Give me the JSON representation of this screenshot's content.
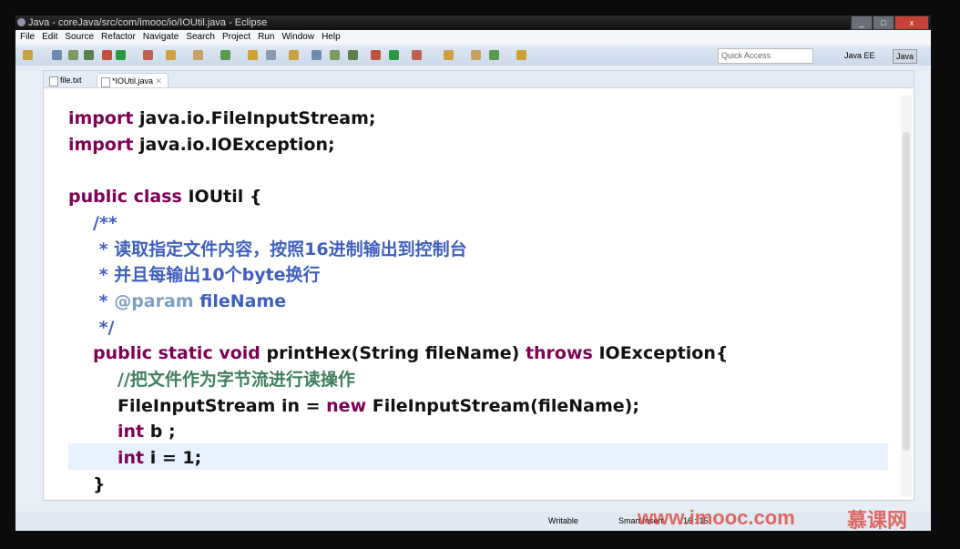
{
  "window": {
    "title": "Java - coreJava/src/com/imooc/io/IOUtil.java - Eclipse"
  },
  "menu": [
    "File",
    "Edit",
    "Source",
    "Refactor",
    "Navigate",
    "Search",
    "Project",
    "Run",
    "Window",
    "Help"
  ],
  "toolbar": {
    "quick_access_placeholder": "Quick Access",
    "perspectives": [
      "Java EE",
      "Java"
    ]
  },
  "tabs": [
    {
      "label": "file.txt",
      "active": false
    },
    {
      "label": "*IOUtil.java",
      "active": true
    }
  ],
  "code": [
    {
      "parts": [
        [
          "kw",
          "import"
        ],
        [
          "",
          "java.io.FileInputStream;"
        ]
      ],
      "indent": 0
    },
    {
      "parts": [
        [
          "kw",
          "import"
        ],
        [
          "",
          "java.io.IOException;"
        ]
      ],
      "indent": 0
    },
    {
      "parts": [],
      "indent": 0
    },
    {
      "parts": [
        [
          "kw",
          "public"
        ],
        [
          "kw",
          "class"
        ],
        [
          "",
          "IOUtil {"
        ]
      ],
      "indent": 0
    },
    {
      "parts": [
        [
          "cm",
          "/**"
        ]
      ],
      "indent": 1
    },
    {
      "parts": [
        [
          "cm",
          " * 读取指定文件内容，按照16进制输出到控制台"
        ]
      ],
      "indent": 1
    },
    {
      "parts": [
        [
          "cm",
          " * 并且每输出10个byte换行"
        ]
      ],
      "indent": 1
    },
    {
      "parts": [
        [
          "cm",
          " *"
        ],
        [
          "tg",
          "@param"
        ],
        [
          "cm",
          "fileName"
        ]
      ],
      "indent": 1
    },
    {
      "parts": [
        [
          "cm",
          " */"
        ]
      ],
      "indent": 1
    },
    {
      "parts": [
        [
          "kw",
          "public"
        ],
        [
          "kw",
          "static"
        ],
        [
          "kw",
          "void"
        ],
        [
          "",
          "printHex(String fileName)"
        ],
        [
          "kw",
          "throws"
        ],
        [
          "",
          "IOException{"
        ]
      ],
      "indent": 1
    },
    {
      "parts": [
        [
          "cm2",
          "//把文件作为字节流进行读操作"
        ]
      ],
      "indent": 2
    },
    {
      "parts": [
        [
          "",
          "FileInputStream in ="
        ],
        [
          "kw",
          "new"
        ],
        [
          "",
          "FileInputStream(fileName);"
        ]
      ],
      "indent": 2
    },
    {
      "parts": [
        [
          "kw",
          "int"
        ],
        [
          "",
          "b ;"
        ]
      ],
      "indent": 2
    },
    {
      "parts": [
        [
          "kw",
          "int"
        ],
        [
          "",
          "i = 1;"
        ]
      ],
      "indent": 2
    },
    {
      "parts": [
        [
          "",
          "}"
        ]
      ],
      "indent": 1
    }
  ],
  "status": {
    "mode": "Writable",
    "insert": "Smart Insert",
    "position": "16 : 15"
  },
  "watermark": {
    "url": "www.imooc.com",
    "brand": "慕课网"
  }
}
